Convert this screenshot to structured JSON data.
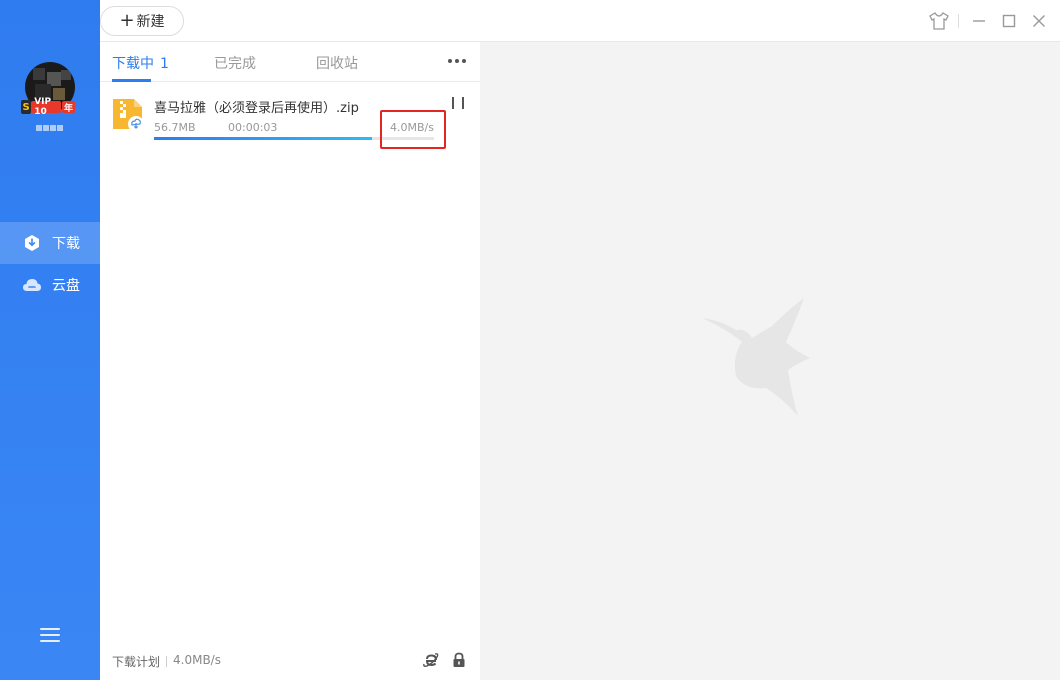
{
  "sidebar": {
    "vip": {
      "s": "S",
      "label": "VIP 10",
      "year": "年"
    },
    "nav": [
      {
        "label": "下载",
        "icon": "download-shield-icon",
        "active": true
      },
      {
        "label": "云盘",
        "icon": "cloud-icon",
        "active": false
      }
    ],
    "menu_icon": "hamburger-menu-icon"
  },
  "topbar": {
    "new_label": "新建",
    "new_plus": "+",
    "icons": [
      "skin-shirt-icon",
      "minimize-icon",
      "maximize-icon",
      "close-icon"
    ]
  },
  "tabs": [
    {
      "label": "下载中",
      "count": "1",
      "active": true
    },
    {
      "label": "已完成",
      "count": "",
      "active": false
    },
    {
      "label": "回收站",
      "count": "",
      "active": false
    }
  ],
  "task": {
    "name": "喜马拉雅（必须登录后再使用）.zip",
    "size": "56.7MB",
    "time_left": "00:00:03",
    "speed": "4.0MB/s",
    "progress": 0.78,
    "file_icon": "zip-file-cloud-icon"
  },
  "footer": {
    "plan_label": "下载计划",
    "speed": "4.0MB/s",
    "icons": [
      "ie-browser-icon",
      "lock-icon"
    ]
  },
  "colors": {
    "accent": "#2d7cf0",
    "sidebar": "#3a86f5",
    "highlight": "#e3261f"
  }
}
